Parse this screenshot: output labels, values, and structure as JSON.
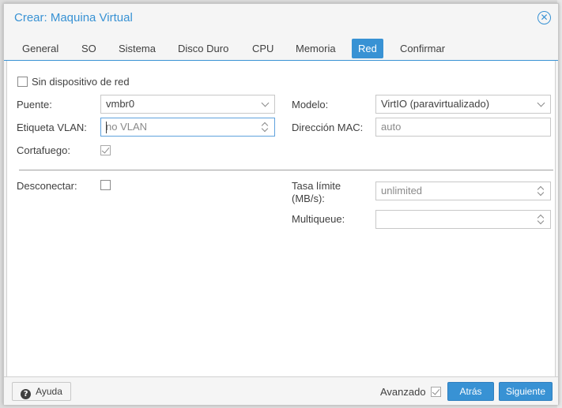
{
  "window": {
    "title": "Crear: Maquina Virtual",
    "close_icon": "close-circle-icon"
  },
  "tabs": [
    {
      "label": "General",
      "active": false
    },
    {
      "label": "SO",
      "active": false
    },
    {
      "label": "Sistema",
      "active": false
    },
    {
      "label": "Disco Duro",
      "active": false
    },
    {
      "label": "CPU",
      "active": false
    },
    {
      "label": "Memoria",
      "active": false
    },
    {
      "label": "Red",
      "active": true
    },
    {
      "label": "Confirmar",
      "active": false
    }
  ],
  "form": {
    "no_network_device": {
      "label": "Sin dispositivo de red",
      "checked": false
    },
    "bridge": {
      "label": "Puente:",
      "value": "vmbr0"
    },
    "vlan_tag": {
      "label": "Etiqueta VLAN:",
      "placeholder": "no VLAN"
    },
    "firewall": {
      "label": "Cortafuego:",
      "checked": true
    },
    "model": {
      "label": "Modelo:",
      "value": "VirtIO (paravirtualizado)"
    },
    "mac_address": {
      "label": "Dirección MAC:",
      "placeholder": "auto"
    },
    "disconnect": {
      "label": "Desconectar:",
      "checked": false
    },
    "rate_limit": {
      "label_line1": "Tasa límite",
      "label_line2": "(MB/s):",
      "placeholder": "unlimited"
    },
    "multiqueue": {
      "label": "Multiqueue:",
      "value": ""
    }
  },
  "footer": {
    "help_label": "Ayuda",
    "help_icon": "question-circle-icon",
    "advanced_label": "Avanzado",
    "advanced_checked": true,
    "back_label": "Atrás",
    "next_label": "Siguiente"
  },
  "colors": {
    "accent": "#3892d4",
    "text": "#404040",
    "placeholder": "#8a8a8a"
  }
}
